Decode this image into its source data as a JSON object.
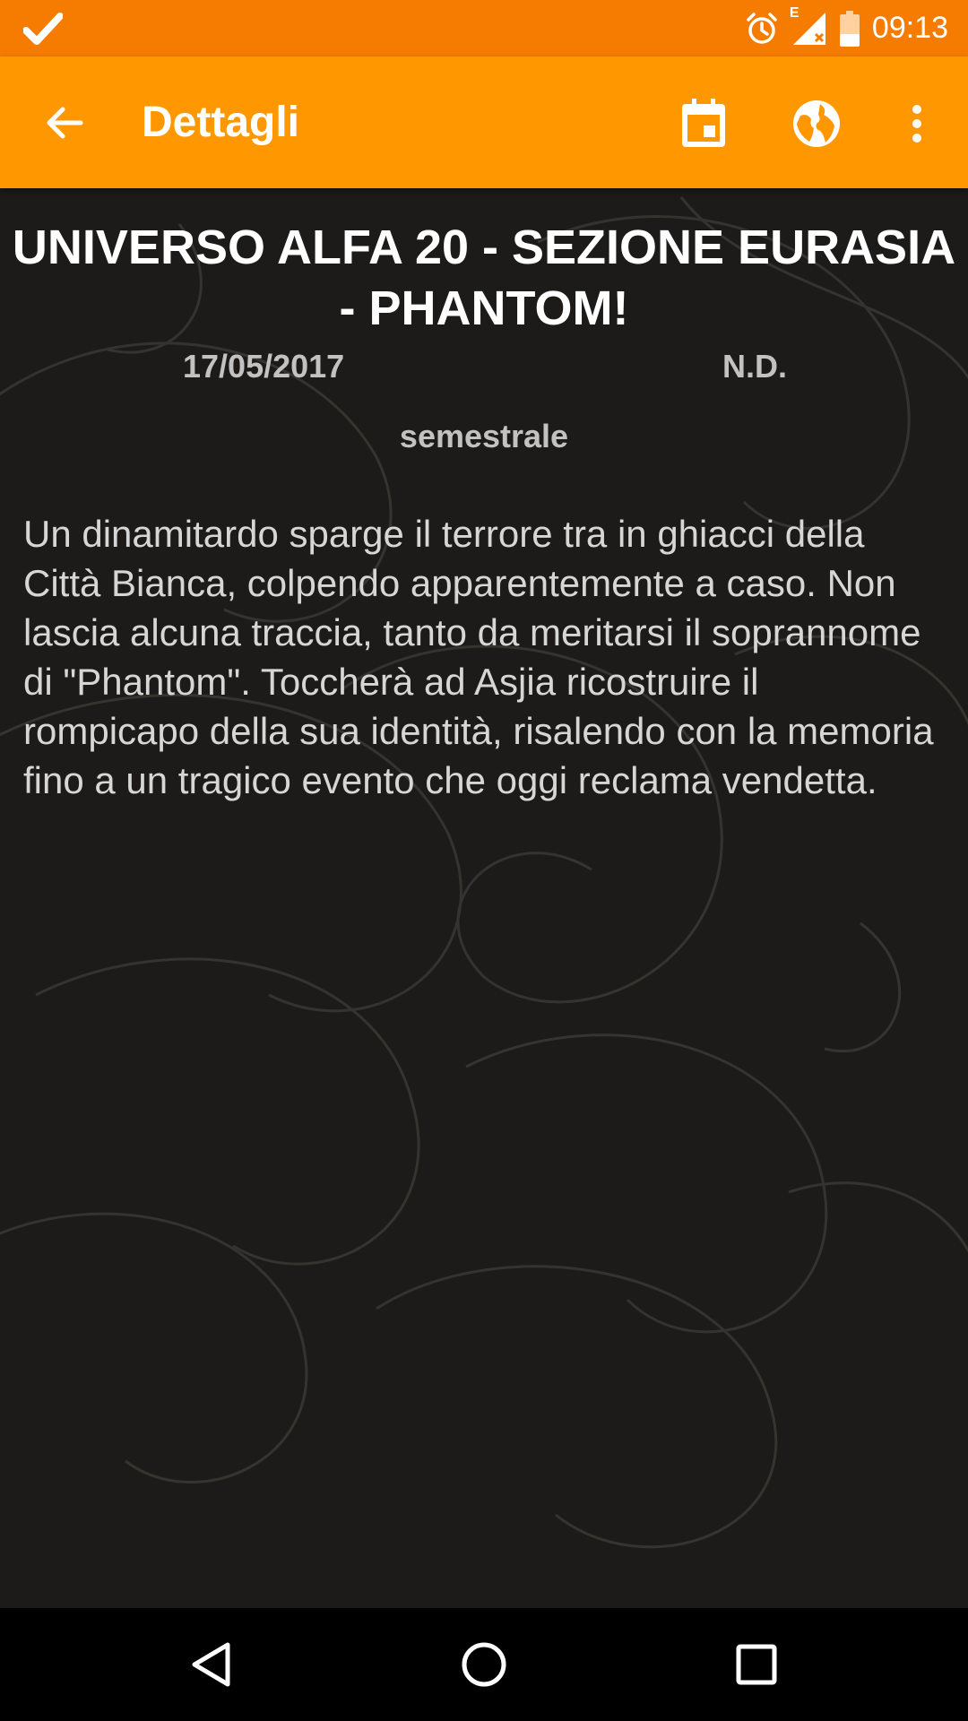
{
  "status_bar": {
    "time": "09:13",
    "icons": [
      "check-icon",
      "alarm-icon",
      "signal-icon",
      "battery-icon"
    ],
    "network_label": "E"
  },
  "app_bar": {
    "title": "Dettagli",
    "actions": [
      "back-arrow-icon",
      "calendar-icon",
      "globe-icon",
      "more-vert-icon"
    ]
  },
  "detail": {
    "title": "UNIVERSO ALFA 20 - SEZIONE EURASIA - PHANTOM!",
    "date": "17/05/2017",
    "price": "N.D.",
    "periodicity": "semestrale",
    "description": "Un dinamitardo sparge il terrore tra in ghiacci della Città Bianca, colpendo apparentemente a caso. Non lascia alcuna traccia, tanto da meritarsi il soprannome di \"Phantom\". Toccherà ad Asjia ricostruire il rompicapo della sua identità, risalendo con la memoria fino a un tragico evento che oggi reclama vendetta."
  },
  "nav_bar": {
    "buttons": [
      "back-triangle-icon",
      "home-circle-icon",
      "recents-square-icon"
    ]
  },
  "colors": {
    "status_bar": "#f57c00",
    "app_bar": "#ff9800",
    "background": "#1c1b19"
  }
}
